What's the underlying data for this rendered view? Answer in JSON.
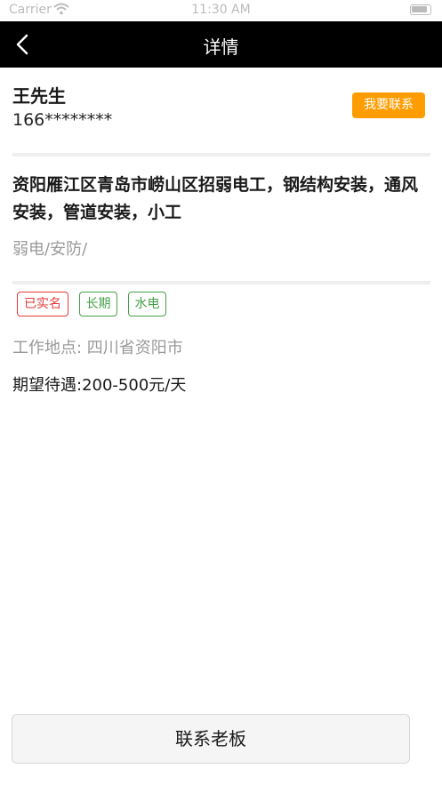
{
  "status_bar": {
    "carrier": "Carrier",
    "time": "11:30 AM"
  },
  "nav": {
    "title": "详情"
  },
  "contact": {
    "name": "王先生",
    "phone": "166********",
    "button_label": "我要联系"
  },
  "job": {
    "title": "资阳雁江区青岛市崂山区招弱电工，钢结构安装，通风安装，管道安装，小工",
    "category": "弱电/安防/",
    "tags": [
      {
        "label": "已实名",
        "style": "red"
      },
      {
        "label": "长期",
        "style": "green"
      },
      {
        "label": "水电",
        "style": "green"
      }
    ],
    "location": "工作地点: 四川省资阳市",
    "salary": "期望待遇:200-500元/天"
  },
  "bottom": {
    "button_label": "联系老板"
  }
}
